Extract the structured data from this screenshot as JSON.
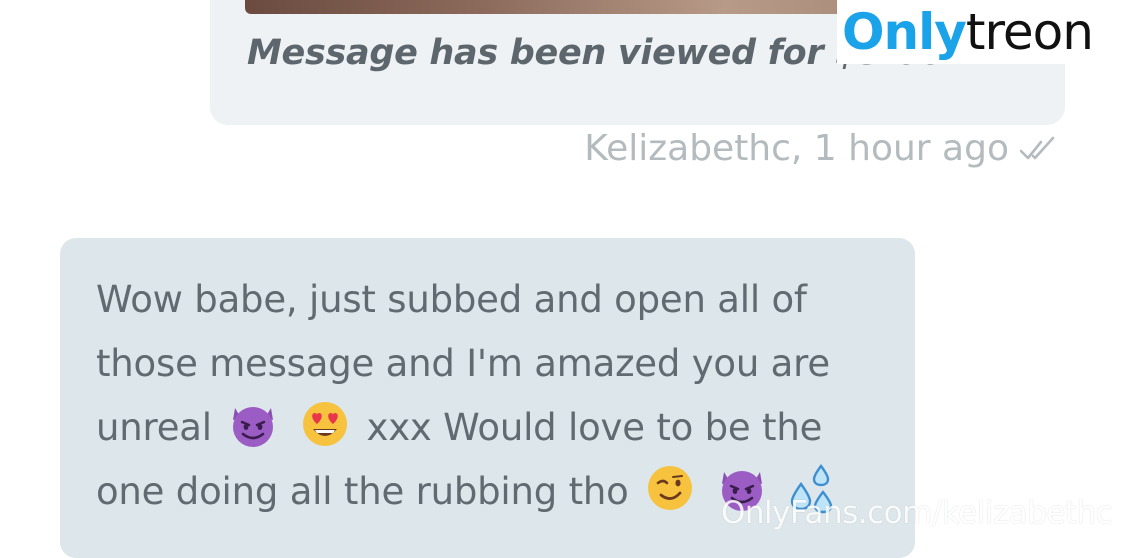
{
  "logo": {
    "part1": "Only",
    "part2": "treon"
  },
  "sent_message": {
    "caption": "Message has been viewed for $3.00",
    "sender": "Kelizabethc",
    "time": "1 hour ago",
    "meta_text": "Kelizabethc, 1 hour ago",
    "status_icon": "double-check-icon"
  },
  "received_message": {
    "lines": [
      "Wow babe, just subbed and open all of",
      "those message and I'm amazed you are",
      "unreal",
      "xxx Would love to be the",
      "one doing all the rubbing tho"
    ],
    "emojis": [
      "smiling-devil-emoji",
      "heart-eyes-emoji",
      "winking-face-emoji",
      "smiling-devil-emoji",
      "sweat-droplets-emoji"
    ]
  },
  "watermark_url": "OnlyFans.com/kelizabethc",
  "colors": {
    "brand_blue": "#1aa3e8",
    "bubble_sent": "#eef2f4",
    "bubble_received": "#dde6ea",
    "text_gray": "#606a70",
    "meta_gray": "#b4bbbf"
  }
}
